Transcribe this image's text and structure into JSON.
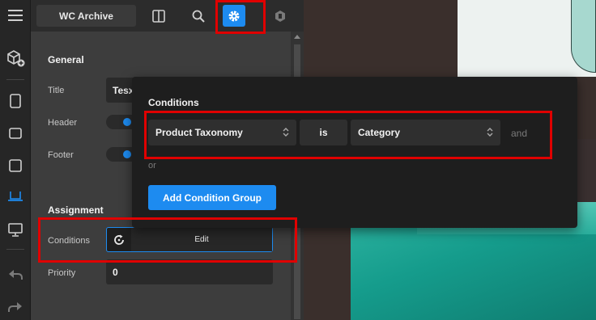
{
  "topbar": {
    "title": "WC Archive",
    "icons": [
      "menu-icon",
      "layout-columns-icon",
      "search-icon",
      "gear-icon",
      "template-badge-icon"
    ]
  },
  "rail": {
    "items": [
      "add-element-icon",
      "mobile-icon",
      "tablet-icon",
      "tablet-landscape-icon",
      "laptop-icon",
      "desktop-icon",
      "undo-icon",
      "redo-icon"
    ]
  },
  "settings": {
    "general_heading": "General",
    "title_label": "Title",
    "title_value": "Tesx",
    "header_label": "Header",
    "footer_label": "Footer",
    "assignment_heading": "Assignment",
    "conditions_label": "Conditions",
    "conditions_button": "Edit",
    "priority_label": "Priority",
    "priority_value": "0"
  },
  "popup": {
    "title": "Conditions",
    "condition": {
      "subject": "Product Taxonomy",
      "operator": "is",
      "value": "Category"
    },
    "and_label": "and",
    "or_label": "or",
    "add_group_button": "Add Condition Group"
  },
  "colors": {
    "accent": "#1d8bf0",
    "highlight": "#e00000",
    "panel_bg": "#3d3d3d",
    "popup_bg": "#1e1e1e"
  }
}
